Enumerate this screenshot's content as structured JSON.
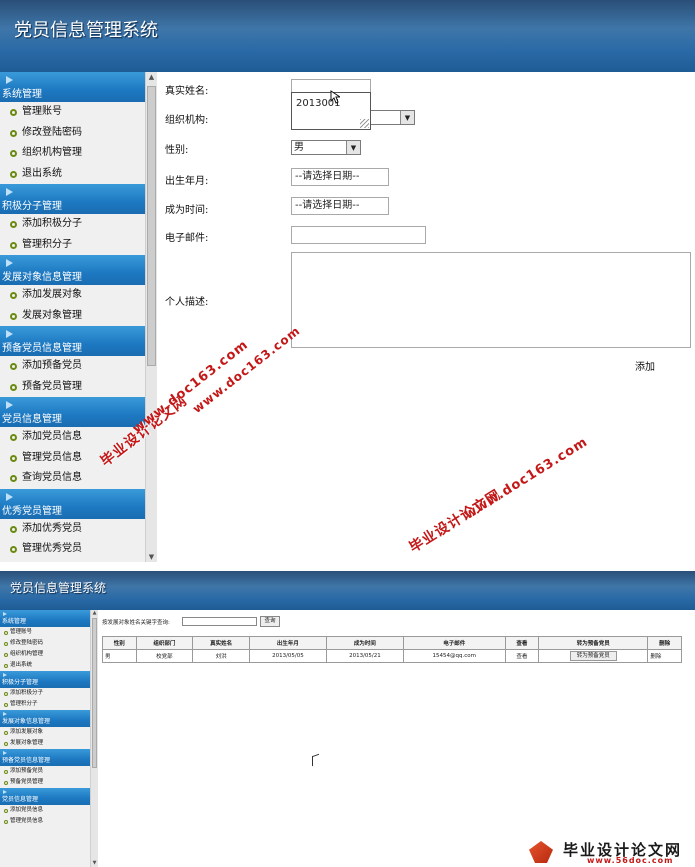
{
  "screen1": {
    "app_title": "党员信息管理系统",
    "sidebar": [
      {
        "title": "系统管理",
        "items": [
          "管理账号",
          "修改登陆密码",
          "组织机构管理",
          "退出系统"
        ]
      },
      {
        "title": "积极分子管理",
        "items": [
          "添加积极分子",
          "管理积分子"
        ]
      },
      {
        "title": "发展对象信息管理",
        "items": [
          "添加发展对象",
          "发展对象管理"
        ]
      },
      {
        "title": "预备党员信息管理",
        "items": [
          "添加预备党员",
          "预备党员管理"
        ]
      },
      {
        "title": "党员信息管理",
        "items": [
          "添加党员信息",
          "管理党员信息",
          "查询党员信息"
        ]
      },
      {
        "title": "优秀党员管理",
        "items": [
          "添加优秀党员",
          "管理优秀党员"
        ]
      }
    ],
    "form": {
      "real_name_label": "真实姓名:",
      "real_name_value": "",
      "autocomplete_suggestion": "2013001",
      "org_label": "组织机构:",
      "org_value": "",
      "gender_label": "性别:",
      "gender_value": "男",
      "birth_label": "出生年月:",
      "birth_value": "--请选择日期--",
      "join_label": "成为时间:",
      "join_value": "--请选择日期--",
      "email_label": "电子邮件:",
      "email_value": "",
      "desc_label": "个人描述:",
      "desc_value": "",
      "submit_label": "添加"
    },
    "watermarks": {
      "site": "www.doc163.com",
      "name": "毕业设计论文网"
    }
  },
  "screen2": {
    "app_title": "党员信息管理系统",
    "sidebar": [
      {
        "title": "系统管理",
        "items": [
          "管理账号",
          "修改登陆密码",
          "组织机构管理",
          "退出系统"
        ]
      },
      {
        "title": "积极分子管理",
        "items": [
          "添加积极分子",
          "管理积分子"
        ]
      },
      {
        "title": "发展对象信息管理",
        "items": [
          "添加发展对象",
          "发展对象管理"
        ]
      },
      {
        "title": "预备党员信息管理",
        "items": [
          "添加预备党员",
          "预备党员管理"
        ]
      },
      {
        "title": "党员信息管理",
        "items": [
          "添加党员信息",
          "管理党员信息"
        ]
      }
    ],
    "search": {
      "label": "按发展对象姓名关键字查询:",
      "value": "",
      "button": "查询"
    },
    "table": {
      "headers": [
        "性别",
        "组织部门",
        "真实姓名",
        "出生年月",
        "成为时间",
        "电子邮件",
        "查看",
        "转为预备党员",
        "删除"
      ],
      "rows": [
        [
          "男",
          "校党部",
          "刘洪",
          "2013/05/05",
          "2013/05/21",
          "15454@qq.com",
          "查看",
          "转为预备党员",
          "删除"
        ]
      ]
    },
    "logo": {
      "name": "毕业设计论文网",
      "site": "www.56doc.com"
    }
  },
  "colors": {
    "header_blue": "#2a6aa6",
    "section_blue": "#1d79c2",
    "watermark_red": "#c41818",
    "bullet_olive": "#6b8a10"
  }
}
